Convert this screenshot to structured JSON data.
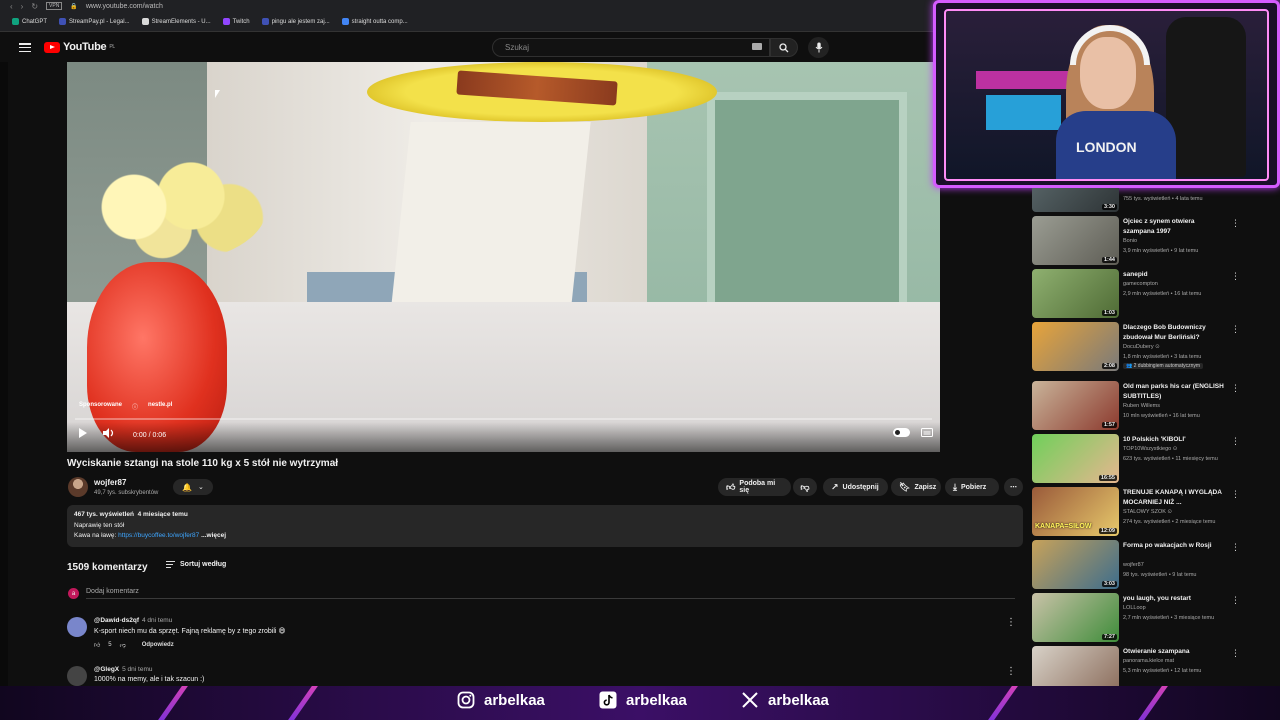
{
  "browser": {
    "url": "www.youtube.com/watch",
    "vpn": "VPN"
  },
  "bookmarks": [
    {
      "label": "ChatGPT",
      "color": "#10a37f"
    },
    {
      "label": "StreamPay.pl - Legal...",
      "color": "#3f51b5"
    },
    {
      "label": "StreamElements - U...",
      "color": "#d9d9d9"
    },
    {
      "label": "Twitch",
      "color": "#9146ff"
    },
    {
      "label": "pingu ale jestem zaj...",
      "color": "#3f51b5"
    },
    {
      "label": "straight outta comp...",
      "color": "#4285f4"
    }
  ],
  "header": {
    "logo": "YouTube",
    "region": "PL",
    "search_placeholder": "Szukaj"
  },
  "player": {
    "sponsored_label": "Sponsorowane",
    "sponsor_domain": "nestle.pl",
    "time": "0:00 / 0:06",
    "progress": 0.0
  },
  "video": {
    "title": "Wyciskanie sztangi na stole 110 kg x 5 stół nie wytrzymał",
    "channel": "wojfer87",
    "subscribers": "49,7 tys. subskrybentów",
    "actions": {
      "like": "Podoba mi się",
      "share": "Udostępnij",
      "save": "Zapisz",
      "download": "Pobierz"
    },
    "description": {
      "views": "467 tys. wyświetleń",
      "age": "4 miesiące temu",
      "line1": "Naprawię ten stół",
      "line2_prefix": "Kawa na ławę:",
      "link": "https://buycoffee.to/wojfer87",
      "more": "...więcej"
    }
  },
  "comments": {
    "count": "1509 komentarzy",
    "sort": "Sortuj według",
    "add_avatar": "a",
    "add_placeholder": "Dodaj komentarz",
    "items": [
      {
        "author": "@Dawid-ds2qf",
        "when": "4 dni temu",
        "text": "K-sport niech mu da sprzęt. Fajną reklamę by z tego zrobili 😄",
        "likes": "5",
        "reply": "Odpowiedz",
        "avatar_color": "#7986cb"
      },
      {
        "author": "@GlegX",
        "when": "5 dni temu",
        "text": "1000% na memy, ale i tak szacun :)",
        "likes": "",
        "reply": "",
        "avatar_color": "#444"
      }
    ]
  },
  "sidebar": {
    "items": [
      {
        "title": "",
        "channel": "",
        "meta": "755 tys. wyświetleń • 4 lata temu",
        "duration": "3:30",
        "thumb": [
          "#5d6b6e",
          "#2e3436"
        ]
      },
      {
        "title": "Ojciec z synem otwiera szampana 1997",
        "channel": "Bonio",
        "meta": "3,9 mln wyświetleń • 9 lat temu",
        "duration": "1:44",
        "thumb": [
          "#9b9d93",
          "#5e5d55"
        ]
      },
      {
        "title": "sanepid",
        "channel": "gamecompton",
        "meta": "2,9 mln wyświetleń • 16 lat temu",
        "duration": "1:03",
        "thumb": [
          "#8fb070",
          "#4f6b35"
        ]
      },
      {
        "title": "Dlaczego Bob Budowniczy zbudował Mur Berliński?",
        "channel": "DocuDubery ⊙",
        "meta": "1,8 mln wyświetleń • 3 lata temu",
        "duration": "2:08",
        "badge": "👥 2 dubbingiem automatycznym",
        "thumb": [
          "#e8a43a",
          "#7a7a7a"
        ]
      },
      {
        "title": "Old man parks his car (ENGLISH SUBTITLES)",
        "channel": "Ruben Willems",
        "meta": "10 mln wyświetleń • 16 lat temu",
        "duration": "1:57",
        "thumb": [
          "#c9b49a",
          "#8c3a2e"
        ]
      },
      {
        "title": "10 Polskich 'KIBOLI'",
        "channel": "TOP10Wszystkiego ⊙",
        "meta": "623 tys. wyświetleń • 11 miesięcy temu",
        "duration": "16:55",
        "thumb": [
          "#6fd05a",
          "#e6b68f"
        ]
      },
      {
        "title": "TRENUJE KANAPĄ I WYGLĄDA MOCARNIEJ NIŻ ...",
        "channel": "STALOWY SZOK ⊙",
        "meta": "274 tys. wyświetleń • 2 miesiące temu",
        "duration": "12:09",
        "thumb_text": "KANAPA=SIŁOW",
        "thumb": [
          "#9a5a3a",
          "#e7c96b"
        ]
      },
      {
        "title": "Forma po wakacjach w Rosji",
        "channel": "wojfer87",
        "meta": "98 tys. wyświetleń • 9 lat temu",
        "duration": "3:03",
        "thumb": [
          "#c7a25a",
          "#3d6d8c"
        ]
      },
      {
        "title": "you laugh, you restart",
        "channel": "LOLLoop",
        "meta": "2,7 mln wyświetleń • 3 miesiące temu",
        "duration": "7:27",
        "thumb": [
          "#c9c2a8",
          "#3f8d3a"
        ]
      },
      {
        "title": "Otwieranie szampana",
        "channel": "panorama.kielce mat",
        "meta": "5,3 mln wyświetleń • 12 lat temu",
        "duration": "",
        "thumb": [
          "#d8d2c8",
          "#8a6b5a"
        ]
      }
    ]
  },
  "webcam": {
    "shirt_text": "LONDON"
  },
  "overlay": {
    "instagram": "arbelkaa",
    "tiktok": "arbelkaa",
    "x": "arbelkaa"
  }
}
